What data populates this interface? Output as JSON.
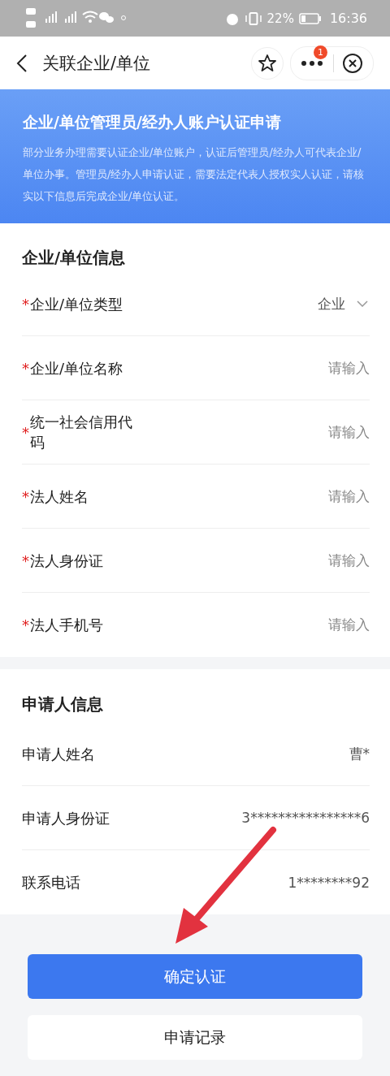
{
  "status_bar": {
    "battery": "22%",
    "time": "16:36"
  },
  "header": {
    "title": "关联企业/单位",
    "badge": "1"
  },
  "banner": {
    "title": "企业/单位管理员/经办人账户认证申请",
    "text": "部分业务办理需要认证企业/单位账户，认证后管理员/经办人可代表企业/单位办事。管理员/经办人申请认证，需要法定代表人授权实人认证，请核实以下信息后完成企业/单位认证。"
  },
  "company_section": {
    "title": "企业/单位信息",
    "fields": [
      {
        "mark": "*",
        "label": "企业/单位类型",
        "kind": "select",
        "value": "企业"
      },
      {
        "mark": "*",
        "label": "企业/单位名称",
        "kind": "input",
        "placeholder": "请输入"
      },
      {
        "mark": "*",
        "label": "统一社会信用代码",
        "kind": "input",
        "placeholder": "请输入"
      },
      {
        "mark": "*",
        "label": "法人姓名",
        "kind": "input",
        "placeholder": "请输入"
      },
      {
        "mark": "*",
        "label": "法人身份证",
        "kind": "input",
        "placeholder": "请输入"
      },
      {
        "mark": "*",
        "label": "法人手机号",
        "kind": "input",
        "placeholder": "请输入"
      }
    ]
  },
  "applicant_section": {
    "title": "申请人信息",
    "fields": [
      {
        "label": "申请人姓名",
        "kind": "text",
        "value": "曹*"
      },
      {
        "label": "申请人身份证",
        "kind": "text",
        "value": "3****************6"
      },
      {
        "label": "联系电话",
        "kind": "text",
        "value": "1********92"
      }
    ]
  },
  "buttons": [
    {
      "label": "确定认证",
      "kind": "primary"
    },
    {
      "label": "申请记录",
      "kind": "secondary"
    }
  ]
}
